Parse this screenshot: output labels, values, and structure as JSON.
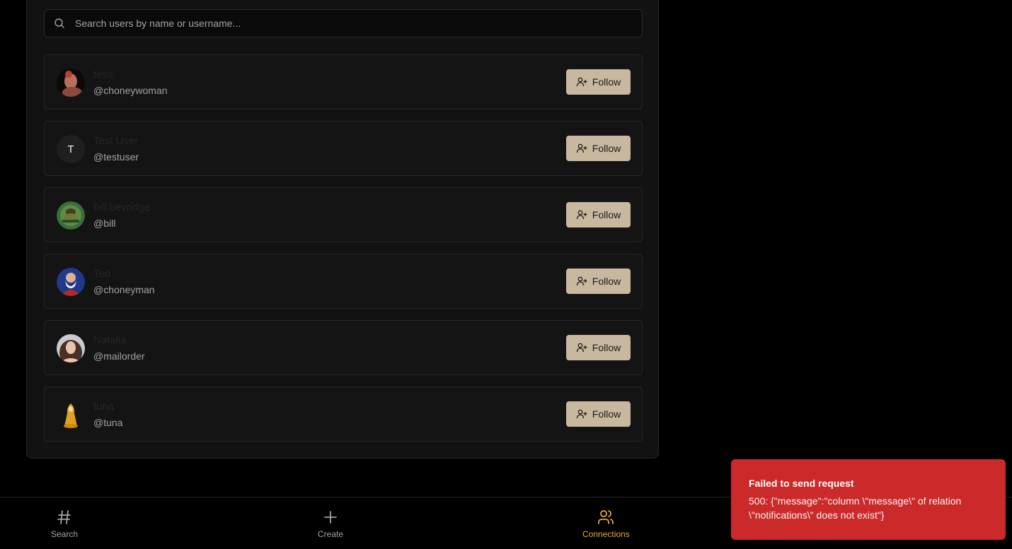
{
  "search": {
    "placeholder": "Search users by name or username..."
  },
  "users": [
    {
      "display_name": "tess",
      "username": "@choneywoman",
      "avatar": "photo-avatar-tess",
      "follow_label": "Follow"
    },
    {
      "display_name": "Test User",
      "username": "@testuser",
      "avatar_initial": "T",
      "follow_label": "Follow"
    },
    {
      "display_name": "bill bevridge",
      "username": "@bill",
      "avatar": "photo-avatar-bill",
      "follow_label": "Follow"
    },
    {
      "display_name": "Ted",
      "username": "@choneyman",
      "avatar": "photo-avatar-ted",
      "follow_label": "Follow"
    },
    {
      "display_name": "Natalia",
      "username": "@mailorder",
      "avatar": "photo-avatar-natalia",
      "follow_label": "Follow"
    },
    {
      "display_name": "tuna",
      "username": "@tuna",
      "avatar": "photo-avatar-tuna",
      "follow_label": "Follow"
    }
  ],
  "nav": {
    "search_label": "Search",
    "create_label": "Create",
    "connections_label": "Connections"
  },
  "toast": {
    "title": "Failed to send request",
    "body": "500: {\"message\":\"column \\\"message\\\" of relation \\\"notifications\\\" does not exist\"}"
  },
  "colors": {
    "accent": "#e8a93a",
    "follow_button": "#c8b8a0",
    "toast_bg": "#cc2a2a"
  }
}
